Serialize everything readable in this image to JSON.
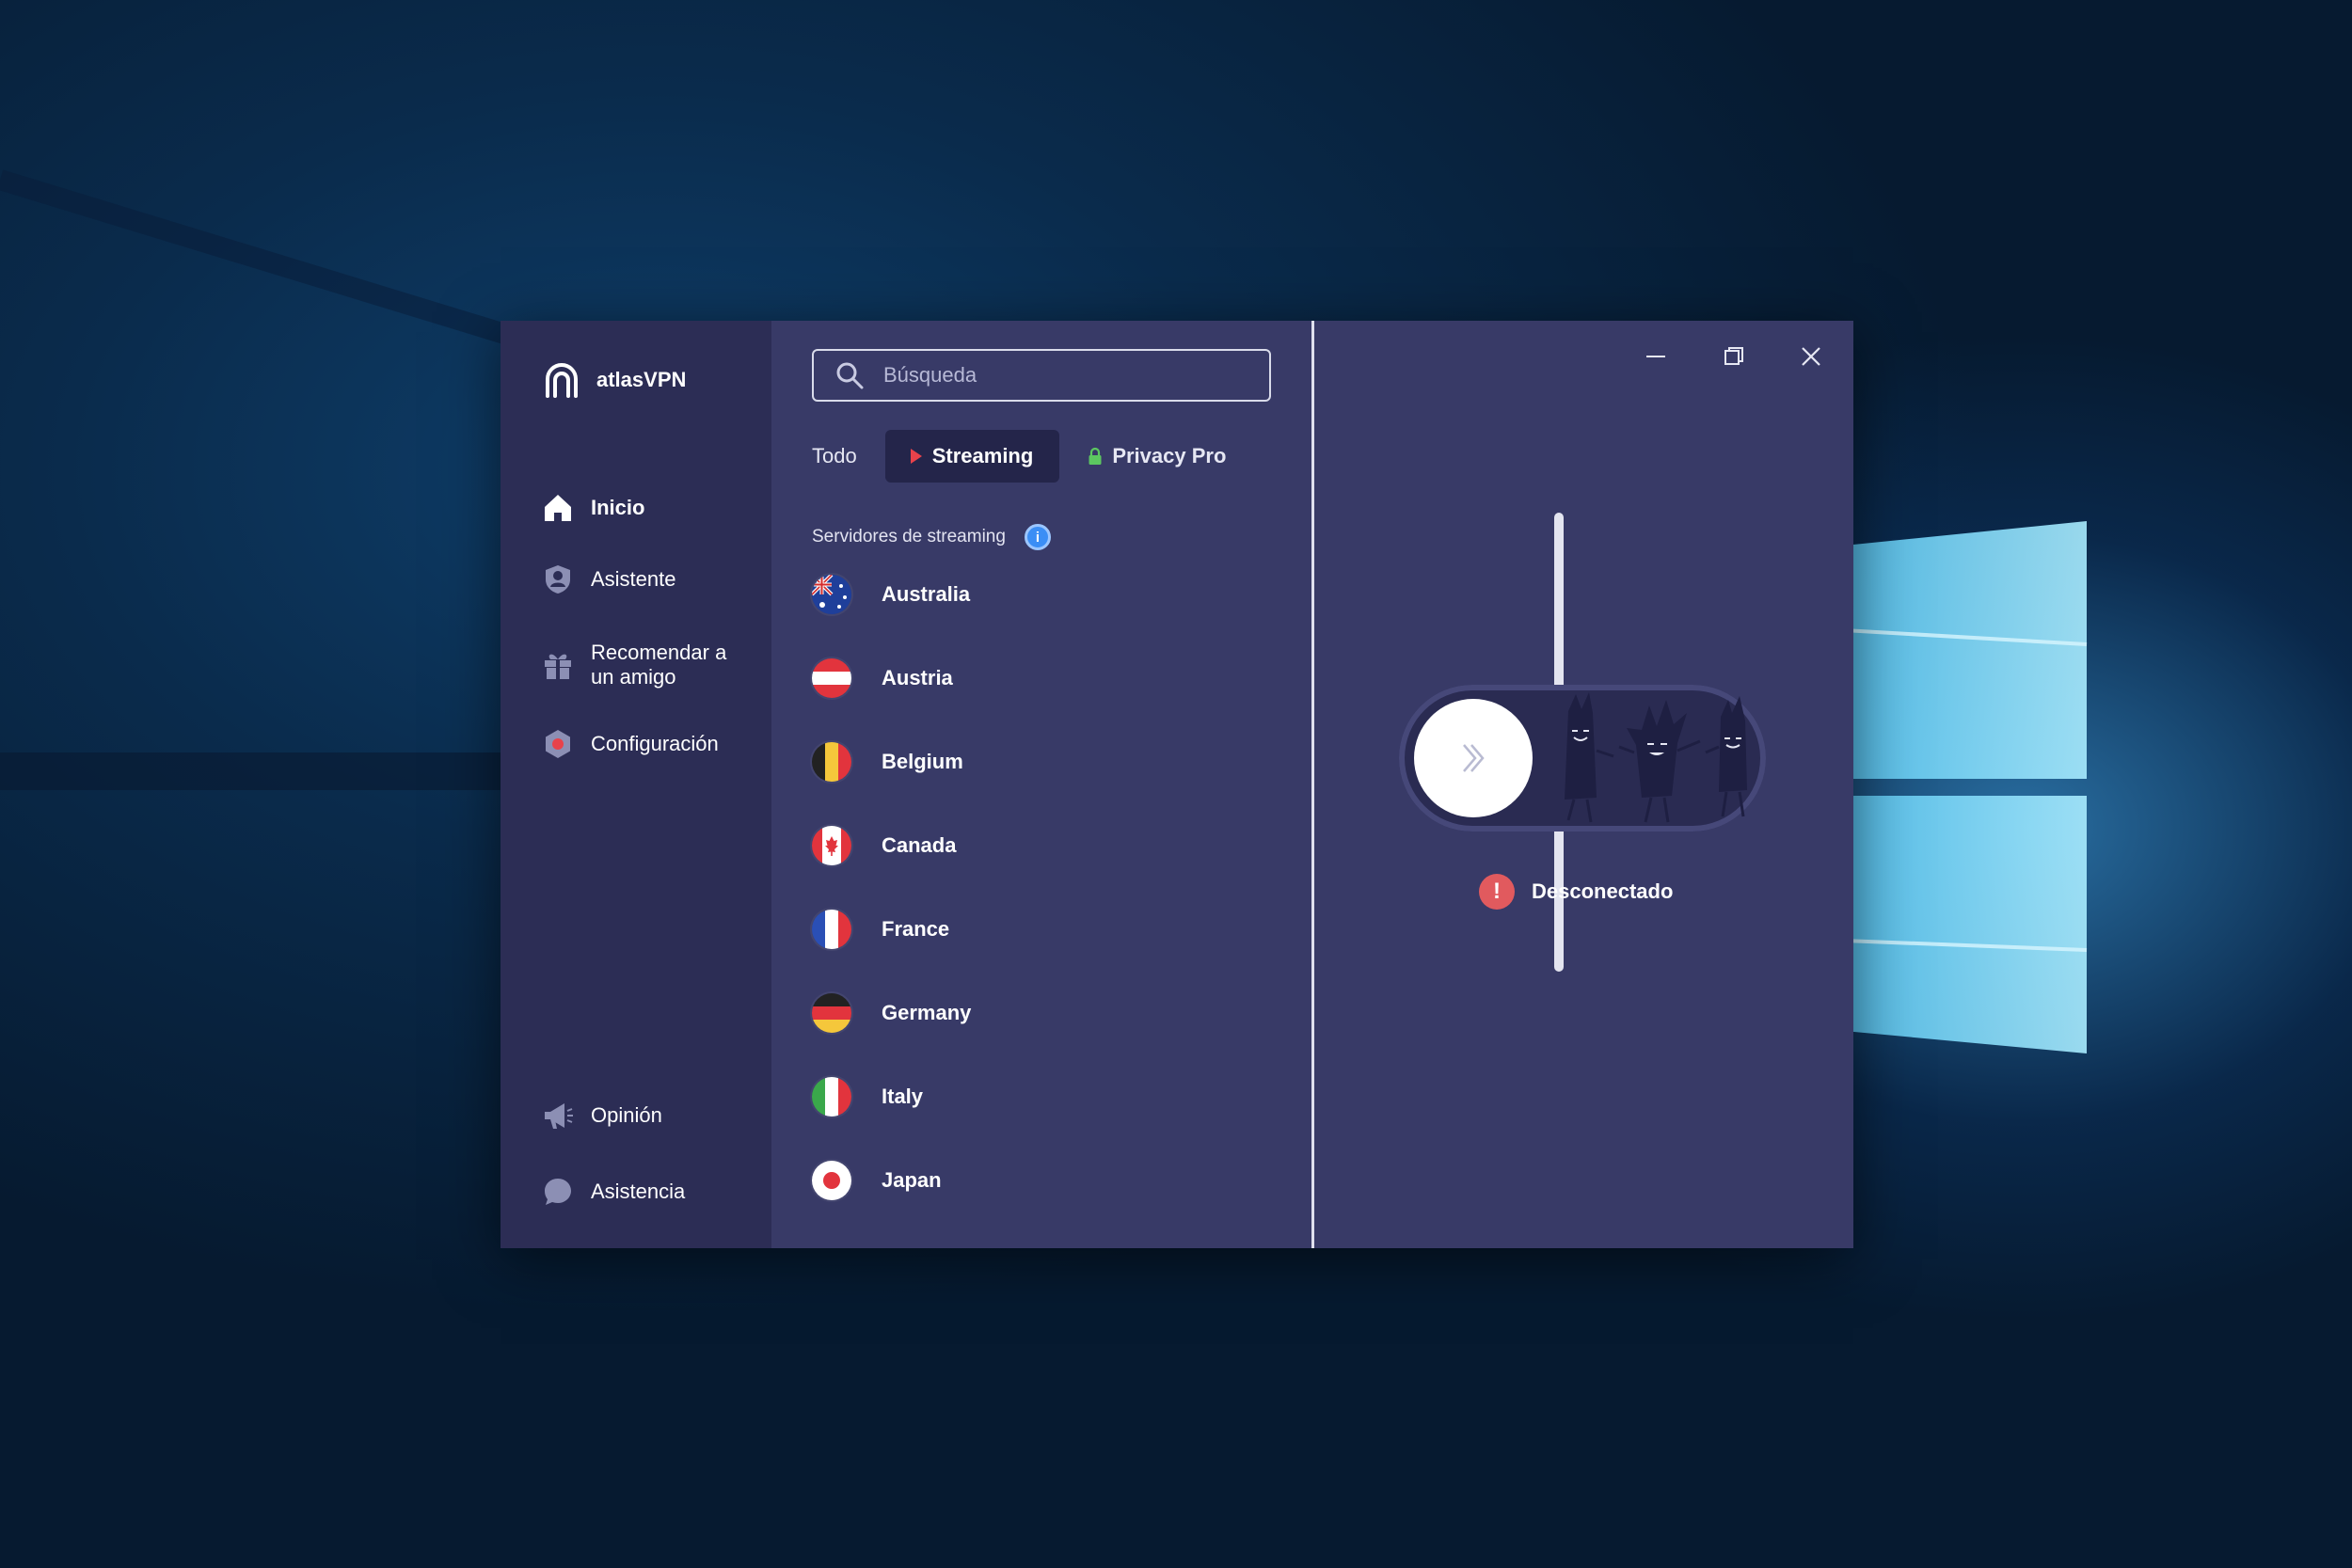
{
  "app": {
    "name": "atlasVPN"
  },
  "sidebar": {
    "items": [
      {
        "label": "Inicio",
        "icon": "home-icon",
        "active": true
      },
      {
        "label": "Asistente",
        "icon": "shield-user-icon",
        "active": false
      },
      {
        "label": "Recomendar a un amigo",
        "line1": "Recomendar a",
        "line2": "un amigo",
        "icon": "gift-icon",
        "active": false
      },
      {
        "label": "Configuración",
        "icon": "settings-icon",
        "active": false
      }
    ],
    "bottom_items": [
      {
        "label": "Opinión",
        "icon": "megaphone-icon"
      },
      {
        "label": "Asistencia",
        "icon": "chat-bubble-icon"
      }
    ]
  },
  "search": {
    "placeholder": "Búsqueda",
    "value": ""
  },
  "tabs": {
    "todo": "Todo",
    "streaming": "Streaming",
    "privacy_pro": "Privacy Pro",
    "selected": "Streaming"
  },
  "list": {
    "section_title": "Servidores de streaming",
    "countries": [
      "Australia",
      "Austria",
      "Belgium",
      "Canada",
      "France",
      "Germany",
      "Italy",
      "Japan"
    ]
  },
  "connection": {
    "status": "Desconectado"
  },
  "colors": {
    "sidebar_bg": "#2c2d55",
    "panel_bg": "#383a67",
    "selected_tab_bg": "#24254a",
    "info_blue": "#3b8ef5",
    "error_red": "#e15a5e",
    "streaming_red": "#e8424b",
    "privacy_green": "#5cc760"
  }
}
